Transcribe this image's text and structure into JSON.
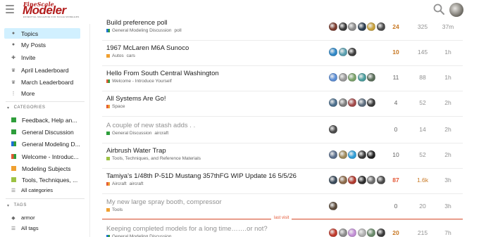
{
  "header": {
    "logo_line1": "FineScale",
    "logo_line2": "Modeler",
    "logo_tagline": "ESSENTIAL MAGAZINE FOR SCALE MODELERS"
  },
  "sidebar": {
    "nav": [
      {
        "label": "Topics",
        "icon": "topics-icon"
      },
      {
        "label": "My Posts",
        "icon": "user-icon"
      },
      {
        "label": "Invite",
        "icon": "invite-icon"
      },
      {
        "label": "April Leaderboard",
        "icon": "crown-icon"
      },
      {
        "label": "March Leaderboard",
        "icon": "crown-icon"
      },
      {
        "label": "More",
        "icon": "more-icon"
      }
    ],
    "categories_heading": "CATEGORIES",
    "categories": [
      {
        "label": "Feedback, Help an...",
        "color": "#2e9e3b"
      },
      {
        "label": "General Discussion",
        "color": "#2e9e3b"
      },
      {
        "label": "General Modeling D...",
        "color": "#1e6fd9"
      },
      {
        "label": "Welcome - Introduc...",
        "color": "#2e9e3b"
      },
      {
        "label": "Modeling Subjects",
        "color": "#f0a030"
      },
      {
        "label": "Tools, Techniques, ...",
        "color": "#9cc243"
      }
    ],
    "all_categories": "All categories",
    "tags_heading": "TAGS",
    "tags": [
      {
        "label": "armor"
      }
    ],
    "all_tags": "All tags"
  },
  "topics": [
    {
      "title": "Build preference poll",
      "category": "General Modeling Discussion",
      "cat_color_a": "#1e6fd9",
      "cat_color_b": "#2e9e3b",
      "tags": [
        "poll"
      ],
      "posters": [
        "#7a3b2e",
        "#3a3a3a",
        "#8c8c8c",
        "#2c3e50",
        "#c9a23b",
        "#4a4a4a"
      ],
      "replies": "24",
      "replies_style": "warm",
      "views": "325",
      "views_style": "",
      "activity": "37m",
      "visited": false
    },
    {
      "title": "1967 McLaren M6A Sunoco",
      "category": "Autos",
      "cat_color_a": "#f0a030",
      "cat_color_b": "#f0a030",
      "tags": [
        "cars"
      ],
      "posters": [
        "#2f88c8",
        "#5a9fb0",
        "#3d3d3d"
      ],
      "replies": "10",
      "replies_style": "warm",
      "views": "145",
      "views_style": "",
      "activity": "1h",
      "visited": false
    },
    {
      "title": "Hello From South Central Washington",
      "category": "Welcome - Introduce Yourself",
      "cat_color_a": "#e45735",
      "cat_color_b": "#2e9e3b",
      "tags": [],
      "posters": [
        "#5b8ed6",
        "#999999",
        "#7aa36a",
        "#4a9e9e",
        "#5a6e5a"
      ],
      "replies": "11",
      "replies_style": "",
      "views": "88",
      "views_style": "",
      "activity": "1h",
      "visited": false
    },
    {
      "title": "All Systems Are Go!",
      "category": "Space",
      "cat_color_a": "#e45735",
      "cat_color_b": "#f0a030",
      "tags": [],
      "posters": [
        "#4b6e8c",
        "#7d7d7d",
        "#a34a4a",
        "#5d6d7e",
        "#3a3a3a"
      ],
      "replies": "4",
      "replies_style": "",
      "views": "52",
      "views_style": "",
      "activity": "2h",
      "visited": false
    },
    {
      "title": "A couple of new stash adds . .",
      "category": "General Discussion",
      "cat_color_a": "#2e9e3b",
      "cat_color_b": "#2e9e3b",
      "tags": [
        "aircraft"
      ],
      "posters": [
        "#4a4a4a"
      ],
      "replies": "0",
      "replies_style": "",
      "views": "14",
      "views_style": "",
      "activity": "2h",
      "visited": true
    },
    {
      "title": "Airbrush Water Trap",
      "category": "Tools, Techniques, and Reference Materials",
      "cat_color_a": "#9cc243",
      "cat_color_b": "#9cc243",
      "tags": [],
      "posters": [
        "#5a6e8c",
        "#a08a5a",
        "#2f9ed8",
        "#3a3a3a",
        "#222222"
      ],
      "replies": "10",
      "replies_style": "",
      "views": "52",
      "views_style": "",
      "activity": "2h",
      "visited": false
    },
    {
      "title": "Tamiya's 1/48th P-51D Mustang 357thFG WIP Update 16 5/5/26",
      "category": "Aircraft",
      "cat_color_a": "#e45735",
      "cat_color_b": "#f0a030",
      "tags": [
        "aircraft"
      ],
      "posters": [
        "#3a4a5a",
        "#8c6a4a",
        "#b03a2e",
        "#2c2c2c",
        "#6b6b6b",
        "#4a4a4a"
      ],
      "replies": "87",
      "replies_style": "hot",
      "views": "1.6k",
      "views_style": "warm",
      "activity": "3h",
      "visited": false
    },
    {
      "title": "My new large spray booth, compressor",
      "category": "Tools",
      "cat_color_a": "#f0a030",
      "cat_color_b": "#f0a030",
      "tags": [],
      "posters": [
        "#5a4a3a"
      ],
      "replies": "0",
      "replies_style": "",
      "views": "20",
      "views_style": "",
      "activity": "3h",
      "visited": true
    },
    {
      "title": "Keeping completed models for a long time…….or not?",
      "category": "General Modeling Discussion",
      "cat_color_a": "#1e6fd9",
      "cat_color_b": "#2e9e3b",
      "tags": [],
      "posters": [
        "#c0392b",
        "#8c8c8c",
        "#c38fd6",
        "#b0b0b0",
        "#6a8a6a",
        "#3a3a3a"
      ],
      "replies": "20",
      "replies_style": "warm",
      "views": "215",
      "views_style": "",
      "activity": "7h",
      "visited": true
    }
  ],
  "last_visit_label": "last visit"
}
